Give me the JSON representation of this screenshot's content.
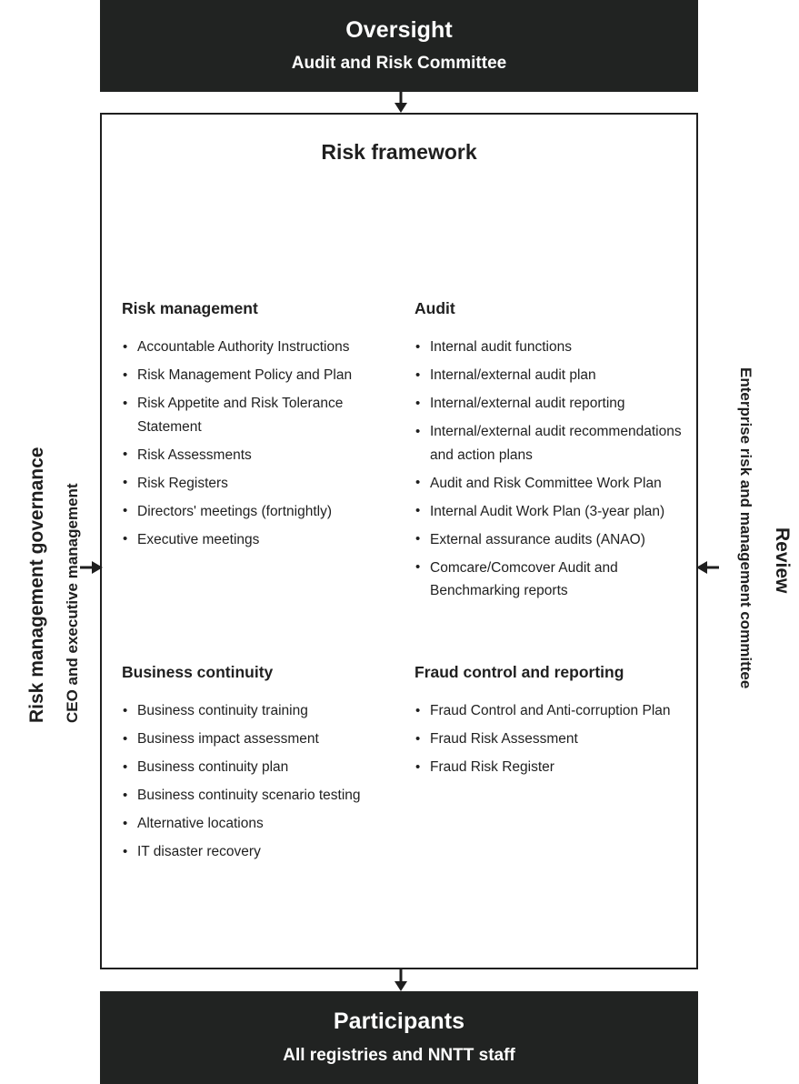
{
  "top_banner": {
    "title": "Oversight",
    "subtitle": "Audit and Risk Committee"
  },
  "bottom_banner": {
    "title": "Participants",
    "subtitle": "All registries and NNTT staff"
  },
  "framework": {
    "title": "Risk framework",
    "sections": [
      {
        "heading": "Risk management",
        "items": [
          "Accountable Authority Instructions",
          "Risk Management Policy and Plan",
          "Risk Appetite and Risk Tolerance Statement",
          "Risk Assessments",
          "Risk Registers",
          "Directors' meetings (fortnightly)",
          "Executive meetings"
        ]
      },
      {
        "heading": "Audit",
        "items": [
          "Internal audit functions",
          "Internal/external audit plan",
          "Internal/external audit reporting",
          "Internal/external audit recommendations and action plans",
          "Audit and Risk Committee Work Plan",
          "Internal Audit Work Plan (3-year plan)",
          "External assurance audits (ANAO)",
          "Comcare/Comcover Audit and Benchmarking reports"
        ]
      },
      {
        "heading": "Business continuity",
        "items": [
          "Business continuity training",
          "Business impact assessment",
          "Business continuity plan",
          "Business continuity scenario testing",
          "Alternative locations",
          "IT disaster recovery"
        ]
      },
      {
        "heading": "Fraud control and reporting",
        "items": [
          "Fraud Control and Anti-corruption Plan",
          "Fraud Risk Assessment",
          "Fraud Risk Register"
        ]
      }
    ]
  },
  "side_labels": {
    "left_primary": "Risk management governance",
    "left_secondary": "CEO and executive management",
    "right_primary": "Review",
    "right_secondary": "Enterprise risk and management committee"
  },
  "colors": {
    "banner_background": "#212322",
    "banner_text": "#ffffff",
    "box_border": "#1f1f1f",
    "body_text": "#1f1f1f",
    "page_background": "#ffffff"
  }
}
